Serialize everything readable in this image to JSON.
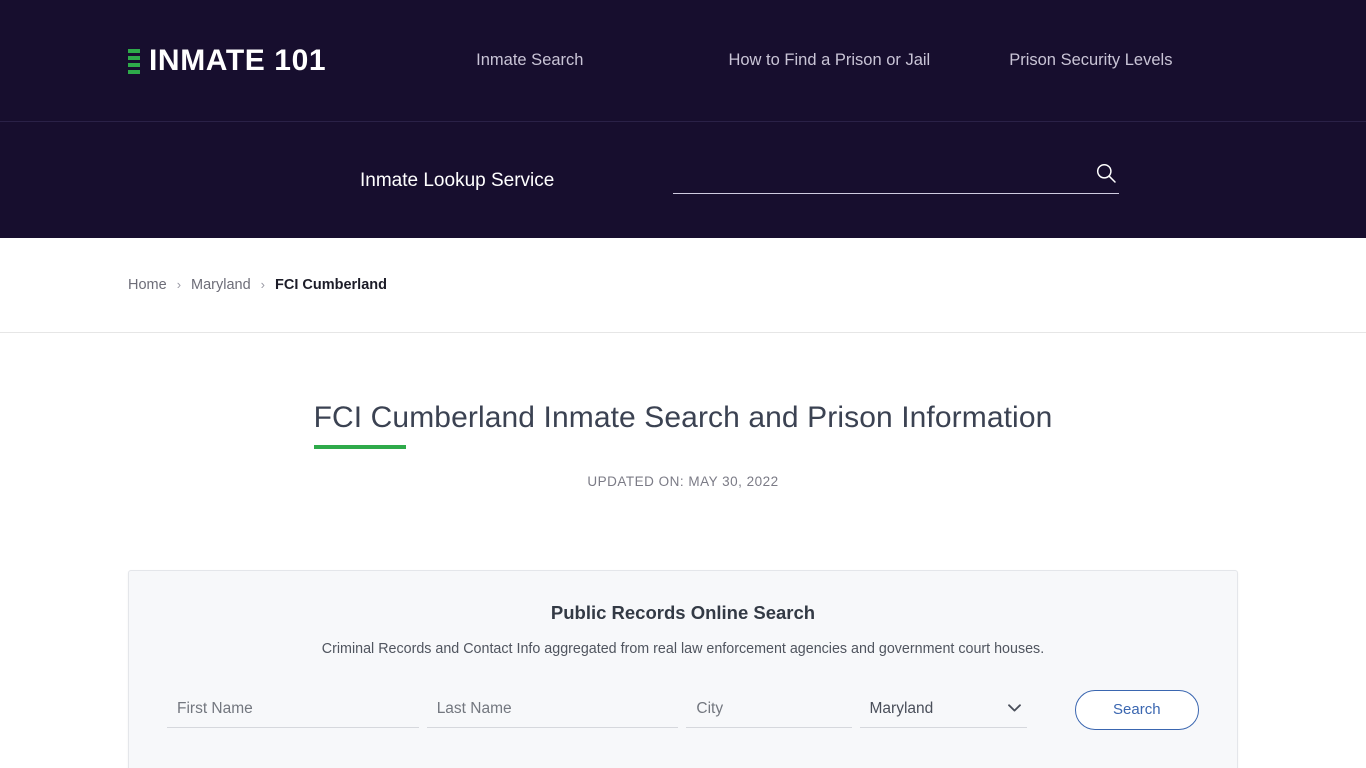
{
  "header": {
    "brand": {
      "icon": "jail-bars-icon",
      "text": "INMATE 101",
      "accent_color": "#2eaa4a"
    },
    "nav": [
      {
        "label": "Inmate Search"
      },
      {
        "label": "How to Find a Prison or Jail"
      },
      {
        "label": "Prison Security Levels"
      }
    ],
    "lookup_label": "Inmate Lookup Service",
    "search": {
      "value": "",
      "placeholder": "",
      "icon": "search-icon"
    },
    "background_color": "#170e2e"
  },
  "breadcrumb": {
    "items": [
      {
        "label": "Home",
        "current": false
      },
      {
        "label": "Maryland",
        "current": false
      },
      {
        "label": "FCI Cumberland",
        "current": true
      }
    ],
    "separator": "›"
  },
  "page": {
    "title": "FCI Cumberland Inmate Search and Prison Information",
    "updated_on": "UPDATED ON: MAY 30, 2022",
    "accent_color": "#2eaa4a"
  },
  "records_card": {
    "title": "Public Records Online Search",
    "subtitle": "Criminal Records and Contact Info aggregated from real law enforcement agencies and government court houses.",
    "fields": {
      "first_name": {
        "placeholder": "First Name",
        "value": ""
      },
      "last_name": {
        "placeholder": "Last Name",
        "value": ""
      },
      "city": {
        "placeholder": "City",
        "value": ""
      },
      "state": {
        "selected": "Maryland",
        "options": [
          "Maryland"
        ]
      }
    },
    "search_button": "Search",
    "button_color": "#3a66b0"
  }
}
